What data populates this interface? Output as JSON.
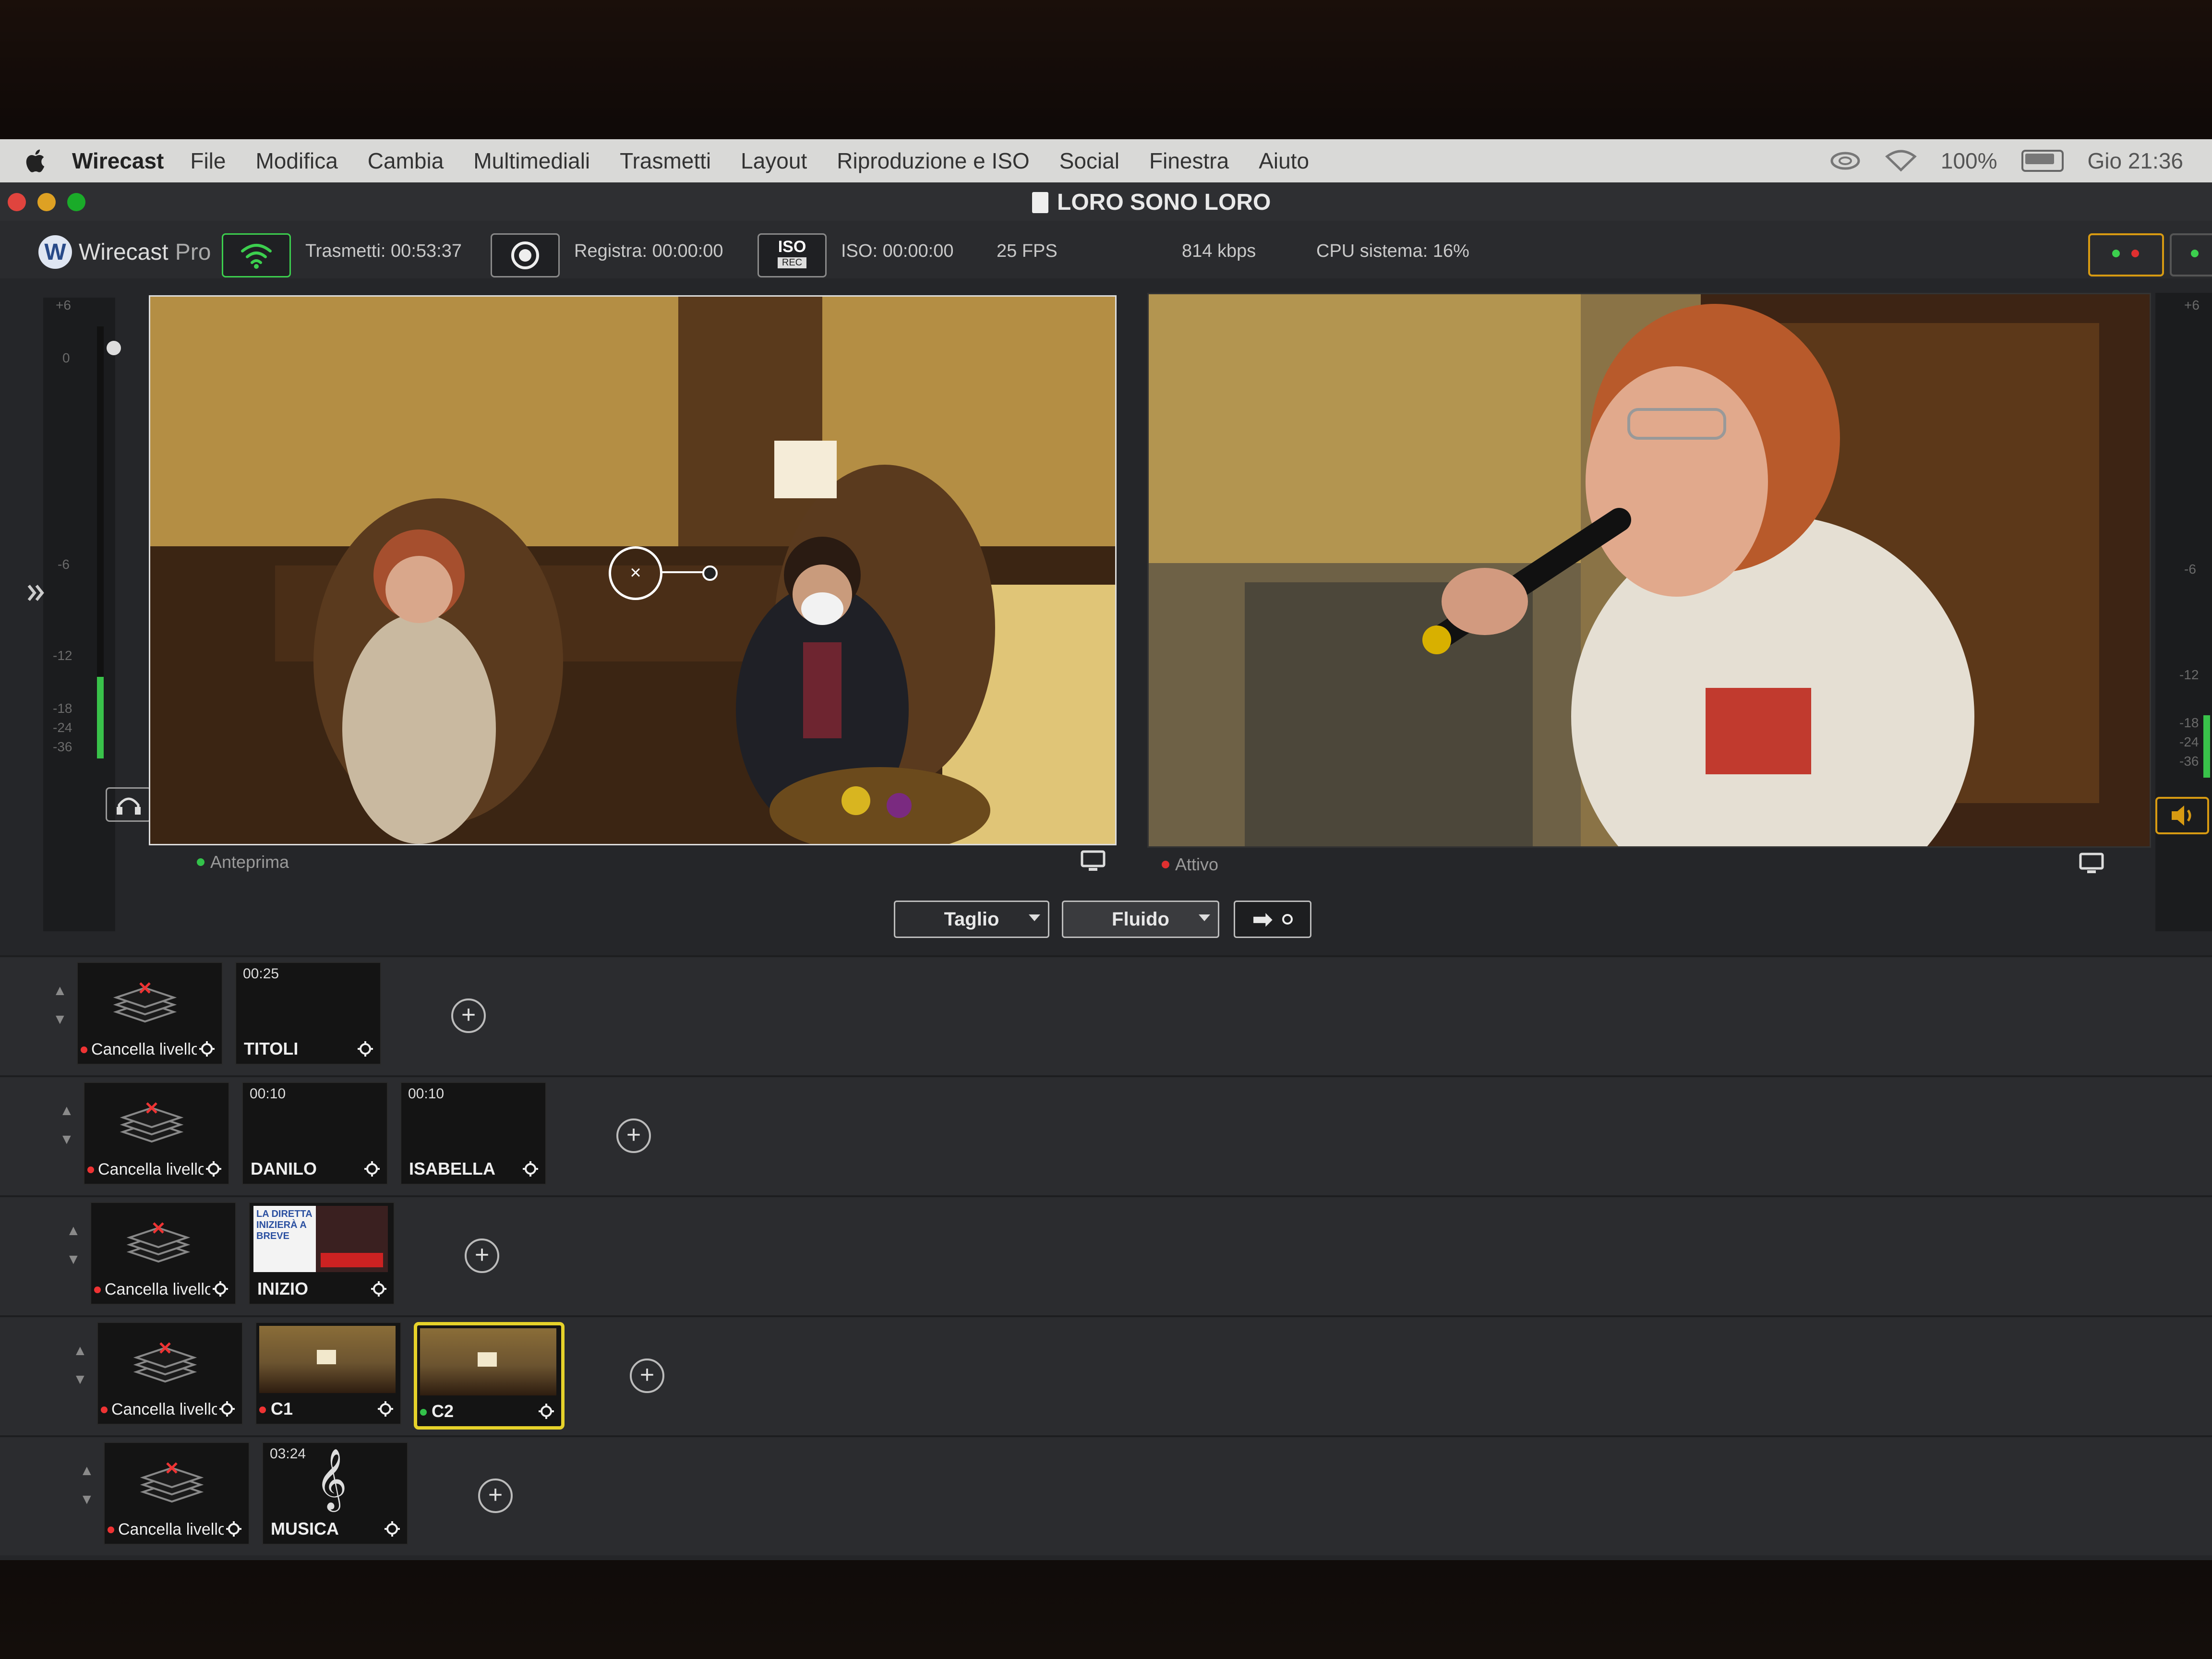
{
  "menubar": {
    "app_name": "Wirecast",
    "items": [
      "File",
      "Modifica",
      "Cambia",
      "Multimediali",
      "Trasmetti",
      "Layout",
      "Riproduzione e ISO",
      "Social",
      "Finestra",
      "Aiuto"
    ],
    "battery": "100%",
    "clock": "Gio 21:36"
  },
  "window": {
    "title": "LORO SONO LORO"
  },
  "toolbar": {
    "logo_text": "Wirecast",
    "logo_suffix": "Pro",
    "broadcast_label": "Trasmetti: 00:53:37",
    "record_label": "Registra: 00:00:00",
    "iso_badge_top": "ISO",
    "iso_badge_bottom": "REC",
    "iso_label": "ISO: 00:00:00",
    "fps": "25 FPS",
    "bitrate": "814 kbps",
    "cpu": "CPU sistema: 16%"
  },
  "meters": {
    "ticks": [
      "+6",
      "0",
      "-6",
      "-12",
      "-18",
      "-24",
      "-36"
    ]
  },
  "preview": {
    "label": "Anteprima",
    "status_color": "#33c24a"
  },
  "live": {
    "label": "Attivo",
    "status_color": "#e03030"
  },
  "transitions": {
    "cut_label": "Taglio",
    "smooth_label": "Fluido",
    "go_symbol": "➡"
  },
  "layers": [
    {
      "clear_label": "Cancella livello",
      "shots": [
        {
          "name": "TITOLI",
          "time": "00:25",
          "thumb": "black"
        }
      ]
    },
    {
      "clear_label": "Cancella livello",
      "shots": [
        {
          "name": "DANILO",
          "time": "00:10",
          "thumb": "black"
        },
        {
          "name": "ISABELLA",
          "time": "00:10",
          "thumb": "black"
        }
      ]
    },
    {
      "clear_label": "Cancella livello",
      "shots": [
        {
          "name": "INIZIO",
          "time": "",
          "thumb": "poster",
          "thumb_text": "LA DIRETTA INIZIERÀ A BREVE"
        }
      ]
    },
    {
      "clear_label": "Cancella livello",
      "shots": [
        {
          "name": "C1",
          "time": "",
          "thumb": "room"
        },
        {
          "name": "C2",
          "time": "",
          "thumb": "room",
          "selected": true
        }
      ]
    },
    {
      "clear_label": "Cancella livello",
      "shots": [
        {
          "name": "MUSICA",
          "time": "03:24",
          "thumb": "music"
        }
      ]
    }
  ],
  "colors": {
    "accent_yellow": "#e6d22a",
    "toolbar_orange": "#d79a12",
    "wifi_green": "#3ccf4e"
  }
}
